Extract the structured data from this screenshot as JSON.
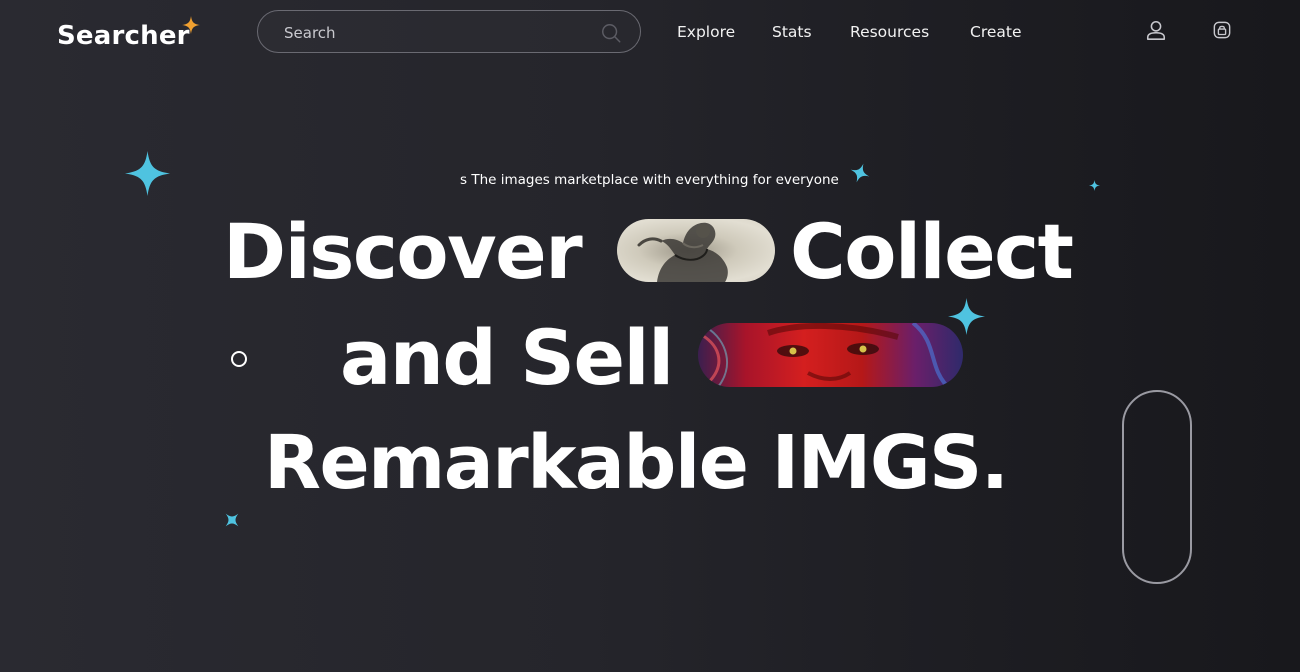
{
  "brand": {
    "logo_text": "Searcher",
    "accent_color": "#f0a030"
  },
  "search": {
    "placeholder": "Search",
    "value": ""
  },
  "nav": {
    "items": [
      {
        "label": "Explore"
      },
      {
        "label": "Stats"
      },
      {
        "label": "Resources"
      },
      {
        "label": "Create"
      }
    ]
  },
  "header_icons": {
    "account": "user-icon",
    "wallet": "lock-icon"
  },
  "hero": {
    "tagline": "s The images marketplace with everything for everyone",
    "line1_a": "Discover",
    "line1_b": "Collect",
    "line2": "and Sell",
    "line3": "Remarkable IMGS.",
    "sparkle_color": "#4fc3e0"
  }
}
